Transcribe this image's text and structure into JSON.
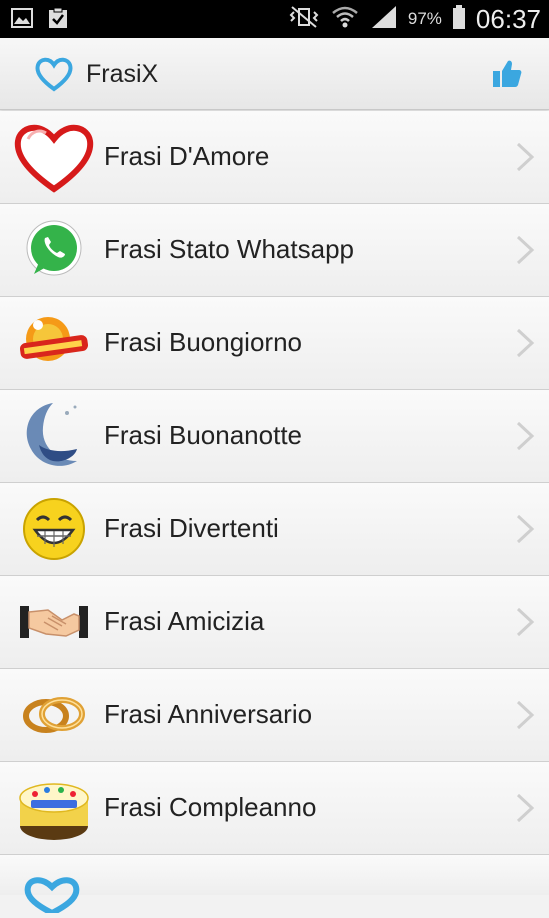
{
  "status_bar": {
    "battery_percent": "97%",
    "time": "06:37",
    "icons": [
      "gallery-icon",
      "clipboard-check-icon",
      "mute-vibrate-icon",
      "wifi-icon",
      "signal-icon",
      "battery-icon"
    ]
  },
  "action_bar": {
    "title": "FrasiX",
    "logo_icon": "heart-outline-icon",
    "action_icon": "thumbs-up-icon",
    "accent_color": "#3ba7e0"
  },
  "list": {
    "items": [
      {
        "label": "Frasi D'Amore",
        "icon": "red-heart-icon"
      },
      {
        "label": "Frasi Stato Whatsapp",
        "icon": "whatsapp-icon"
      },
      {
        "label": "Frasi Buongiorno",
        "icon": "buongiorno-sun-icon"
      },
      {
        "label": "Frasi Buonanotte",
        "icon": "moon-sleeping-icon"
      },
      {
        "label": "Frasi Divertenti",
        "icon": "laughing-smiley-icon"
      },
      {
        "label": "Frasi Amicizia",
        "icon": "handshake-icon"
      },
      {
        "label": "Frasi Anniversario",
        "icon": "wedding-rings-icon"
      },
      {
        "label": "Frasi Compleanno",
        "icon": "birthday-cake-icon"
      }
    ]
  }
}
